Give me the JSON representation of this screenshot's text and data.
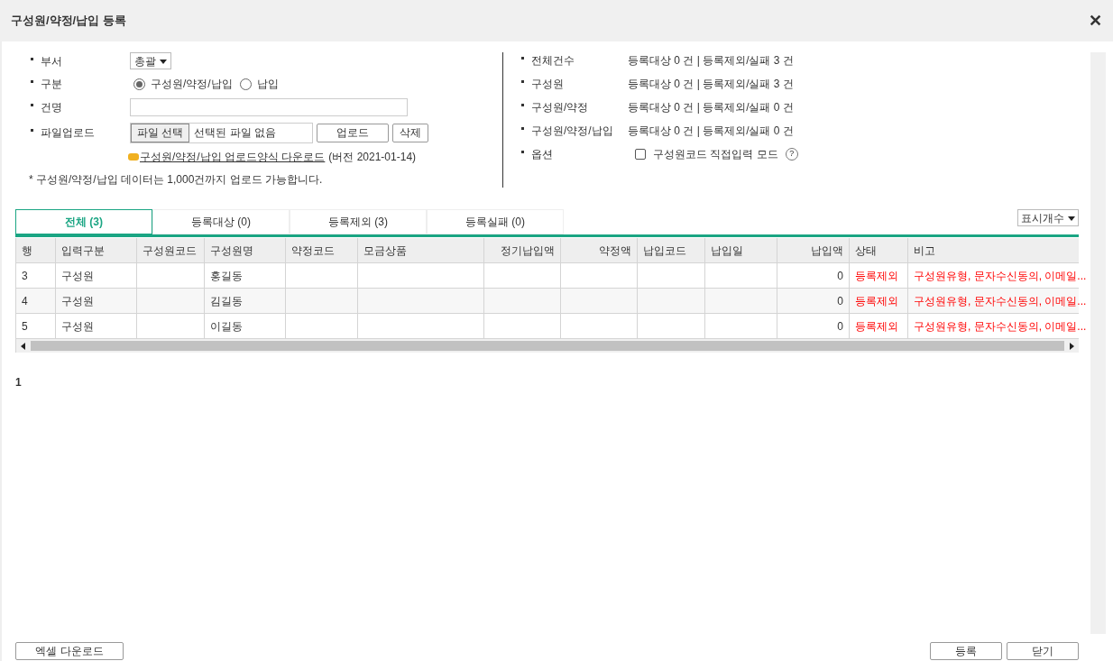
{
  "window": {
    "title": "구성원/약정/납입 등록",
    "close": "✕"
  },
  "form": {
    "department": {
      "label": "부서",
      "value": "총괄"
    },
    "type": {
      "label": "구분",
      "options": [
        {
          "label": "구성원/약정/납입",
          "selected": true
        },
        {
          "label": "납입",
          "selected": false
        }
      ]
    },
    "name": {
      "label": "건명"
    },
    "upload": {
      "label": "파일업로드",
      "choose": "파일 선택",
      "file": "선택된 파일 없음",
      "upload_button": "업로드",
      "delete_button": "삭제"
    },
    "template_link": "구성원/약정/납입 업로드양식 다운로드",
    "template_version": "(버전 2021-01-14)",
    "note": "* 구성원/약정/납입 데이터는 1,000건까지 업로드 가능합니다."
  },
  "summary": [
    {
      "label": "전체건수",
      "value": "등록대상 0 건 | 등록제외/실패 3 건"
    },
    {
      "label": "구성원",
      "value": "등록대상 0 건 | 등록제외/실패 3 건"
    },
    {
      "label": "구성원/약정",
      "value": "등록대상 0 건 | 등록제외/실패 0 건"
    },
    {
      "label": "구성원/약정/납입",
      "value": "등록대상 0 건 | 등록제외/실패 0 건"
    }
  ],
  "option": {
    "label": "옵션",
    "checkbox": "구성원코드 직접입력 모드",
    "checked": false,
    "help": "?"
  },
  "tabs": [
    {
      "label": "전체 (3)",
      "selected": true
    },
    {
      "label": "등록대상 (0)",
      "selected": false
    },
    {
      "label": "등록제외 (3)",
      "selected": false
    },
    {
      "label": "등록실패 (0)",
      "selected": false
    }
  ],
  "page_size": "표시개수",
  "table": {
    "columns": [
      {
        "label": "행",
        "kind": "text"
      },
      {
        "label": "입력구분",
        "kind": "text"
      },
      {
        "label": "구성원코드",
        "kind": "text"
      },
      {
        "label": "구성원명",
        "kind": "text"
      },
      {
        "label": "약정코드",
        "kind": "text"
      },
      {
        "label": "모금상품",
        "kind": "text"
      },
      {
        "label": "정기납입액",
        "kind": "number"
      },
      {
        "label": "약정액",
        "kind": "number"
      },
      {
        "label": "납입코드",
        "kind": "text"
      },
      {
        "label": "납입일",
        "kind": "text"
      },
      {
        "label": "납입액",
        "kind": "number"
      },
      {
        "label": "상태",
        "kind": "alert"
      },
      {
        "label": "비고",
        "kind": "alert"
      }
    ],
    "rows": [
      [
        "3",
        "구성원",
        "",
        "홍길동",
        "",
        "",
        "",
        "",
        "",
        "",
        "0",
        "등록제외",
        "구성원유형, 문자수신동의, 이메일..."
      ],
      [
        "4",
        "구성원",
        "",
        "김길동",
        "",
        "",
        "",
        "",
        "",
        "",
        "0",
        "등록제외",
        "구성원유형, 문자수신동의, 이메일..."
      ],
      [
        "5",
        "구성원",
        "",
        "이길동",
        "",
        "",
        "",
        "",
        "",
        "",
        "0",
        "등록제외",
        "구성원유형, 문자수신동의, 이메일..."
      ]
    ]
  },
  "pagination": [
    {
      "label": "1",
      "selected": true
    }
  ],
  "footer": {
    "excel": "엑셀 다운로드",
    "register": "등록",
    "close": "닫기"
  }
}
